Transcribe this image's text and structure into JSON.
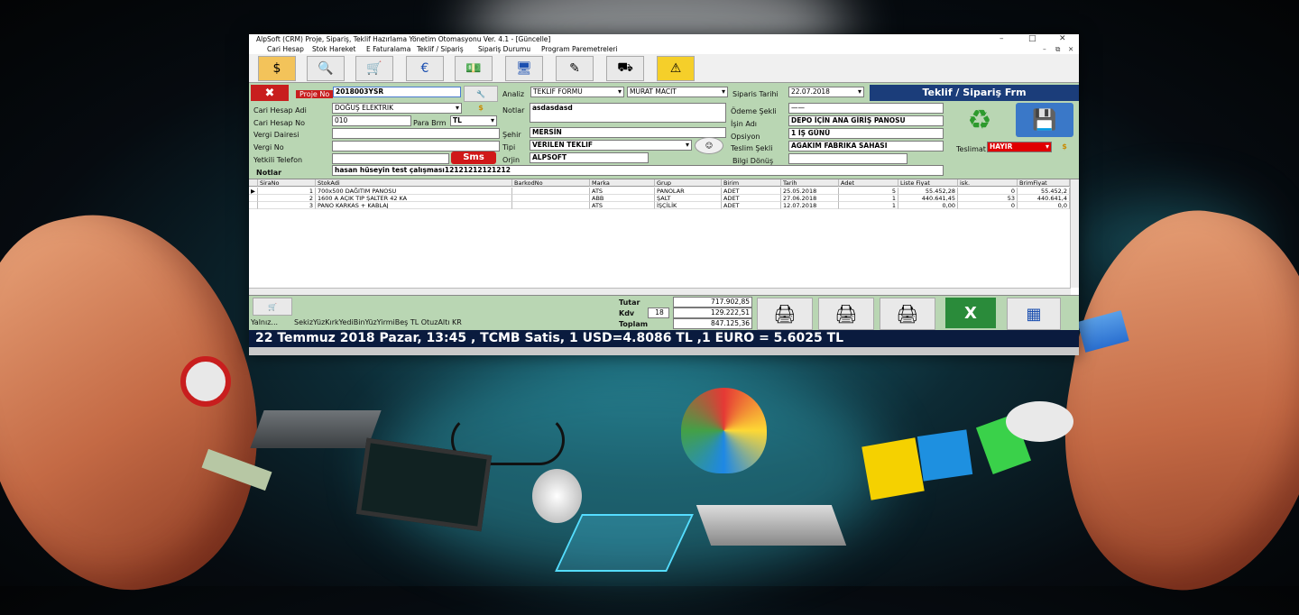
{
  "window": {
    "title": "AlpSoft (CRM) Proje, Sipariş, Teklif Hazırlama Yönetim Otomasyonu  Ver. 4.1   - [Güncelle]",
    "controls": {
      "minimize": "–",
      "maximize": "□",
      "close": "✕"
    },
    "mdi_controls": {
      "minimize": "–",
      "restore": "⧉",
      "close": "✕"
    }
  },
  "menu": [
    "Cari Hesap",
    "Stok Hareket",
    "E Faturalama",
    "Teklif / Sipariş",
    "Sipariş Durumu",
    "Program Paremetreleri"
  ],
  "toolbar_icons": [
    "currency-exchange-icon",
    "invoice-search-icon",
    "add-to-cart-icon",
    "euro-calculator-icon",
    "money-icon",
    "screen-edit-icon",
    "document-pen-icon",
    "hand-truck-icon",
    "warning-car-icon"
  ],
  "form": {
    "panel_title": "Teklif / Sipariş Frm",
    "proje_no_label": "Proje No",
    "proje_no": "2018003YSR",
    "analiz_label": "Analiz",
    "analiz_value": "TEKLIF FORMU",
    "user_value": "MURAT MACIT",
    "siparis_tarihi_label": "Siparis Tarihi",
    "siparis_tarihi": "22.07.2018",
    "cari_hesap_adi_label": "Cari Hesap Adi",
    "cari_hesap_adi": "DOĞUŞ ELEKTRIK",
    "cari_hesap_no_label": "Cari Hesap No",
    "cari_hesap_no": "010",
    "para_brm_label": "Para Brm",
    "para_brm": "TL",
    "vergi_dairesi_label": "Vergi Dairesi",
    "vergi_dairesi": "",
    "vergi_no_label": "Vergi No",
    "vergi_no": "",
    "yetkili_telefon_label": "Yetkili Telefon",
    "yetkili_telefon": "",
    "sms_label": "Sms",
    "notlar_label": "Notlar",
    "notlar": "asdasdasd",
    "sehir_label": "Şehir",
    "sehir": "MERSİN",
    "tipi_label": "Tipi",
    "tipi": "VERILEN TEKLIF",
    "orjin_label": "Orjin",
    "orjin": "ALPSOFT",
    "odeme_sekli_label": "Ödeme Şekli",
    "odeme_sekli": "——",
    "isin_adi_label": "İşin Adı",
    "isin_adi": "DEPO İÇİN ANA GİRİŞ PANOSU",
    "opsiyon_label": "Opsiyon",
    "opsiyon": "1 İŞ GÜNÜ",
    "teslim_sekli_label": "Teslim Şekli",
    "teslim_sekli": "AGAKIM FABRIKA SAHASI",
    "bilgi_donus_label": "Bilgi Dönüş",
    "bilgi_donus": "",
    "teslimat_label": "Teslimat",
    "teslimat": "HAYIR",
    "alt_notlar_label": "Notlar",
    "alt_notlar": "hasan hüseyin test çalışması12121212121212"
  },
  "grid": {
    "columns": [
      "SiraNo",
      "StokAdi",
      "BarkodNo",
      "Marka",
      "Grup",
      "Birim",
      "Tarih",
      "Adet",
      "Liste Fiyat",
      "isk.",
      "BrimFiyat"
    ],
    "rows": [
      [
        "1",
        "700x500 DAĞITIM PANOSU",
        "",
        "ATS",
        "PANOLAR",
        "ADET",
        "25.05.2018",
        "5",
        "55.452,28",
        "0",
        "55.452,2"
      ],
      [
        "2",
        "1600 A AÇIK TIP ŞALTER 42 KA",
        "",
        "ABB",
        "ŞALT",
        "ADET",
        "27.06.2018",
        "1",
        "440.641,45",
        "53",
        "440.641,4"
      ],
      [
        "3",
        "PANO KARKAS + KABLAJ",
        "",
        "ATS",
        "İŞÇİLİK",
        "ADET",
        "12.07.2018",
        "1",
        "0,00",
        "0",
        "0,0"
      ]
    ]
  },
  "footer": {
    "yalniz_label": "Yalnız...",
    "yalniz_text": "SekizYüzKırkYediBinYüzYirmiBeş TL OtuzAltı KR",
    "tutar_label": "Tutar",
    "tutar": "717.902,85",
    "kdv_label": "Kdv",
    "kdv_rate": "18",
    "kdv": "129.222,51",
    "toplam_label": "Toplam",
    "toplam": "847.125,36"
  },
  "ticker": "22 Temmuz 2018 Pazar, 13:45 , TCMB Satis, 1 USD=4.8086 TL ,1 EURO = 5.6025 TL",
  "colors": {
    "form_bg": "#b9d6b3",
    "header_blue": "#1b3d7a",
    "ticker_bg": "#0a1b3e",
    "sms_red": "#d01818",
    "teslimat_red": "#e00000"
  }
}
